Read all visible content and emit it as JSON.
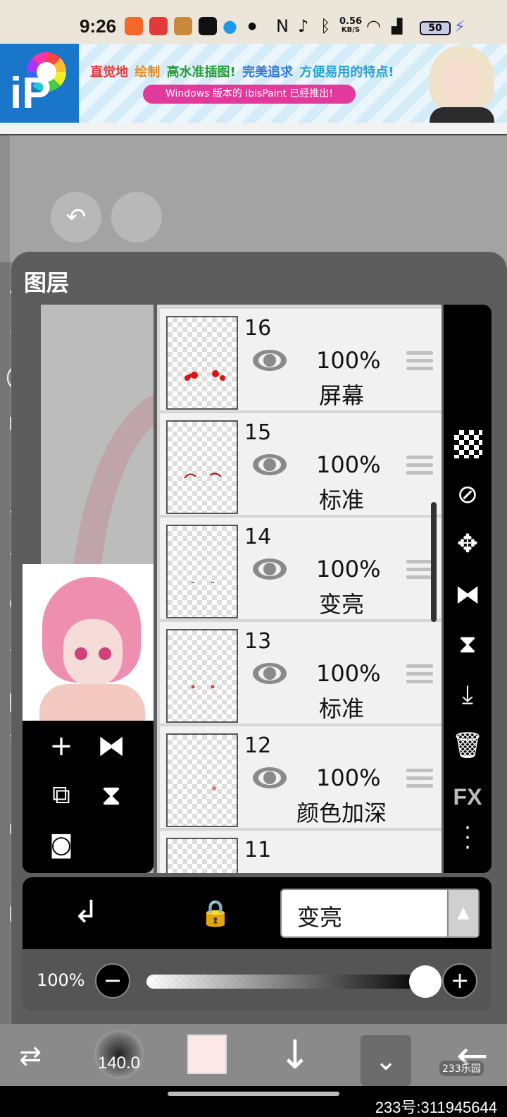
{
  "status_bar": {
    "time": "9:26",
    "net_speed_value": "0.56",
    "net_speed_unit": "KB/S",
    "battery": "50"
  },
  "ad": {
    "headline": [
      {
        "text": "直觉地",
        "color": "#e23a3a"
      },
      {
        "text": "绘制",
        "color": "#e98a1a"
      },
      {
        "text": "高水准插图!",
        "color": "#2a9a3a"
      },
      {
        "text": "完美追求",
        "color": "#2f7ad8"
      },
      {
        "text": "方便易用的特点!",
        "color": "#2aa0d0"
      }
    ],
    "pill": "Windows 版本的 ibisPaint 已经推出!"
  },
  "panel": {
    "title": "图层"
  },
  "layers": [
    {
      "number": "16",
      "opacity": "100%",
      "blend": "屏幕"
    },
    {
      "number": "15",
      "opacity": "100%",
      "blend": "标准"
    },
    {
      "number": "14",
      "opacity": "100%",
      "blend": "变亮"
    },
    {
      "number": "13",
      "opacity": "100%",
      "blend": "标准"
    },
    {
      "number": "12",
      "opacity": "100%",
      "blend": "颜色加深"
    },
    {
      "number": "11",
      "opacity": "",
      "blend": ""
    }
  ],
  "blend_mode": {
    "current": "变亮"
  },
  "opacity_slider": {
    "label": "100%",
    "value_fraction": 1.0
  },
  "toolbar": {
    "brush_size": "140.0",
    "color": "#fde9e8"
  },
  "right_toolbar": {
    "fx_label": "FX"
  },
  "watermark": {
    "logo": "233乐园",
    "id": "233号:311945644"
  },
  "accent_colors": {
    "app_blue": "#1976c8",
    "pill_pink": "#e23a9c"
  }
}
